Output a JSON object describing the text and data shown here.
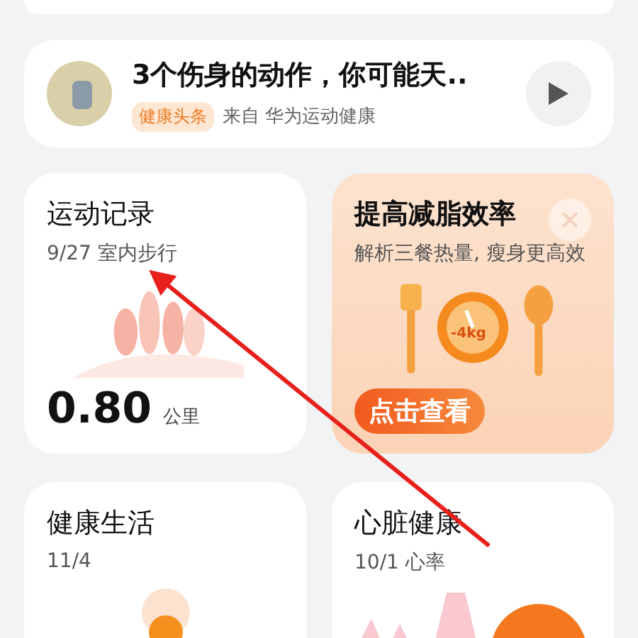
{
  "article": {
    "title": "3个伤身的动作，你可能天..",
    "tag": "健康头条",
    "source": "来自 华为运动健康"
  },
  "cards": [
    {
      "kind": "record",
      "title": "运动记录",
      "subtitle": "9/27  室内步行",
      "value": "0.80",
      "unit": "公里"
    },
    {
      "kind": "promo",
      "title": "提高减脂效率",
      "subtitle": "解析三餐热量, 瘦身更高效",
      "badge": "-4kg",
      "button": "点击查看"
    },
    {
      "kind": "life",
      "title": "健康生活",
      "subtitle": "11/4"
    },
    {
      "kind": "heart",
      "title": "心脏健康",
      "subtitle": "10/1  心率"
    }
  ]
}
